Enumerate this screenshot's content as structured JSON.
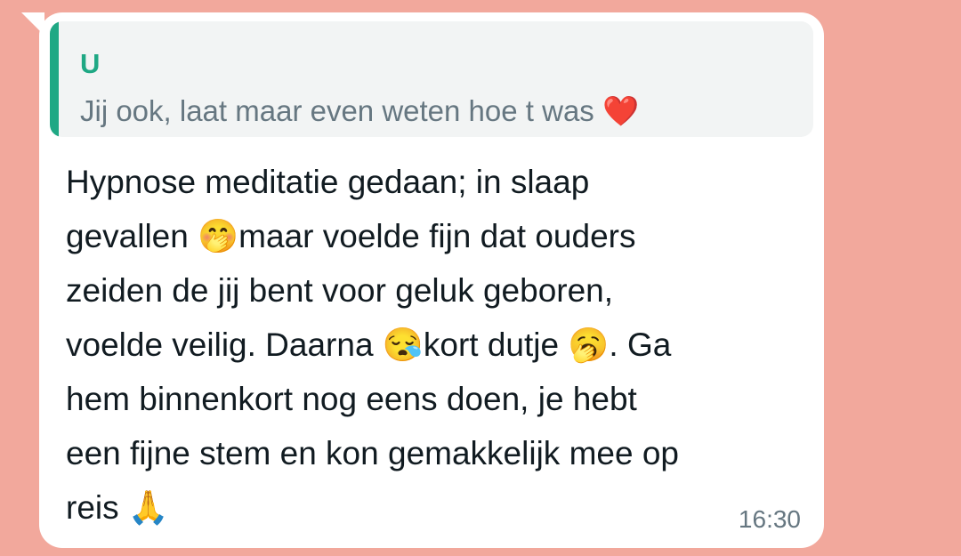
{
  "message": {
    "quoted": {
      "author": "U",
      "text": "Jij ook, laat maar even weten hoe t was ❤️"
    },
    "text": "Hypnose meditatie gedaan; in slaap\ngevallen 🤭maar voelde fijn dat ouders\nzeiden de jij bent voor geluk geboren,\nvoelde veilig. Daarna 😪kort dutje 🥱. Ga\nhem binnenkort nog eens doen, je hebt\neen fijne stem en kon gemakkelijk mee op\nreis 🙏",
    "time": "16:30"
  },
  "colors": {
    "background": "#f2a89c",
    "bubble": "#ffffff",
    "quote_accent": "#1fa884",
    "quote_bg": "#f2f4f4"
  }
}
